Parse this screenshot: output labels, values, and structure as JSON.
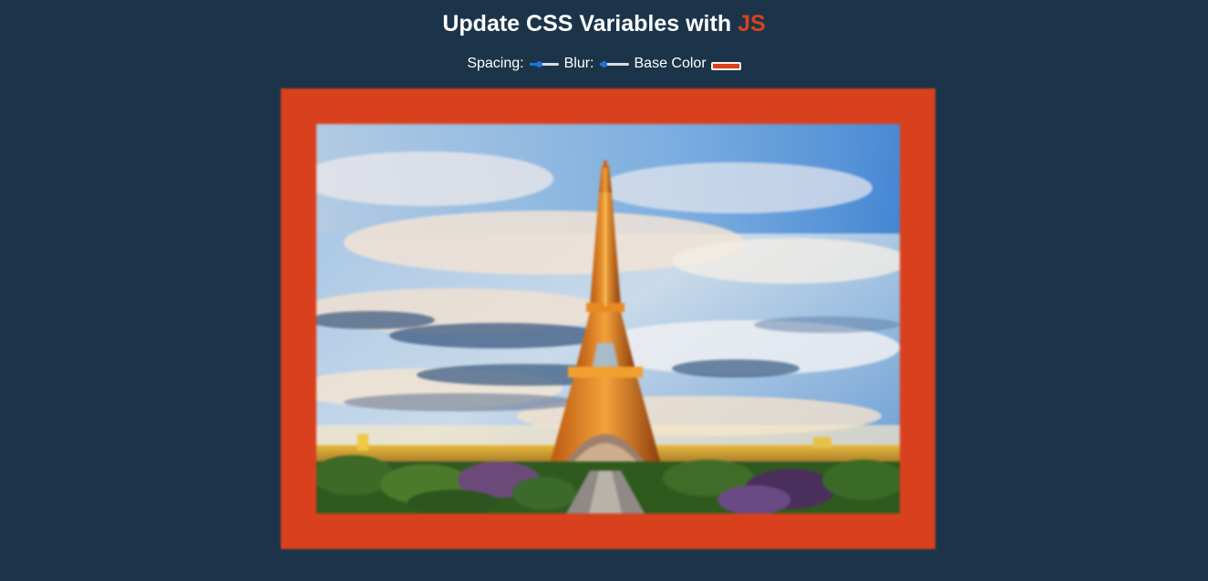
{
  "header": {
    "title_prefix": "Update CSS Variables with",
    "title_highlight": "JS"
  },
  "controls": {
    "spacing_label": "Spacing:",
    "spacing_value": 10,
    "spacing_min": 10,
    "spacing_max": 200,
    "blur_label": "Blur:",
    "blur_value": 0,
    "blur_min": 0,
    "blur_max": 25,
    "base_color_label": "Base Color",
    "base_color_value": "#d9411e"
  },
  "colors": {
    "background": "#1b344a",
    "accent": "#d9411e",
    "slider_accent": "#1d73d9"
  },
  "image": {
    "subject": "eiffel-tower-paris-photo"
  }
}
